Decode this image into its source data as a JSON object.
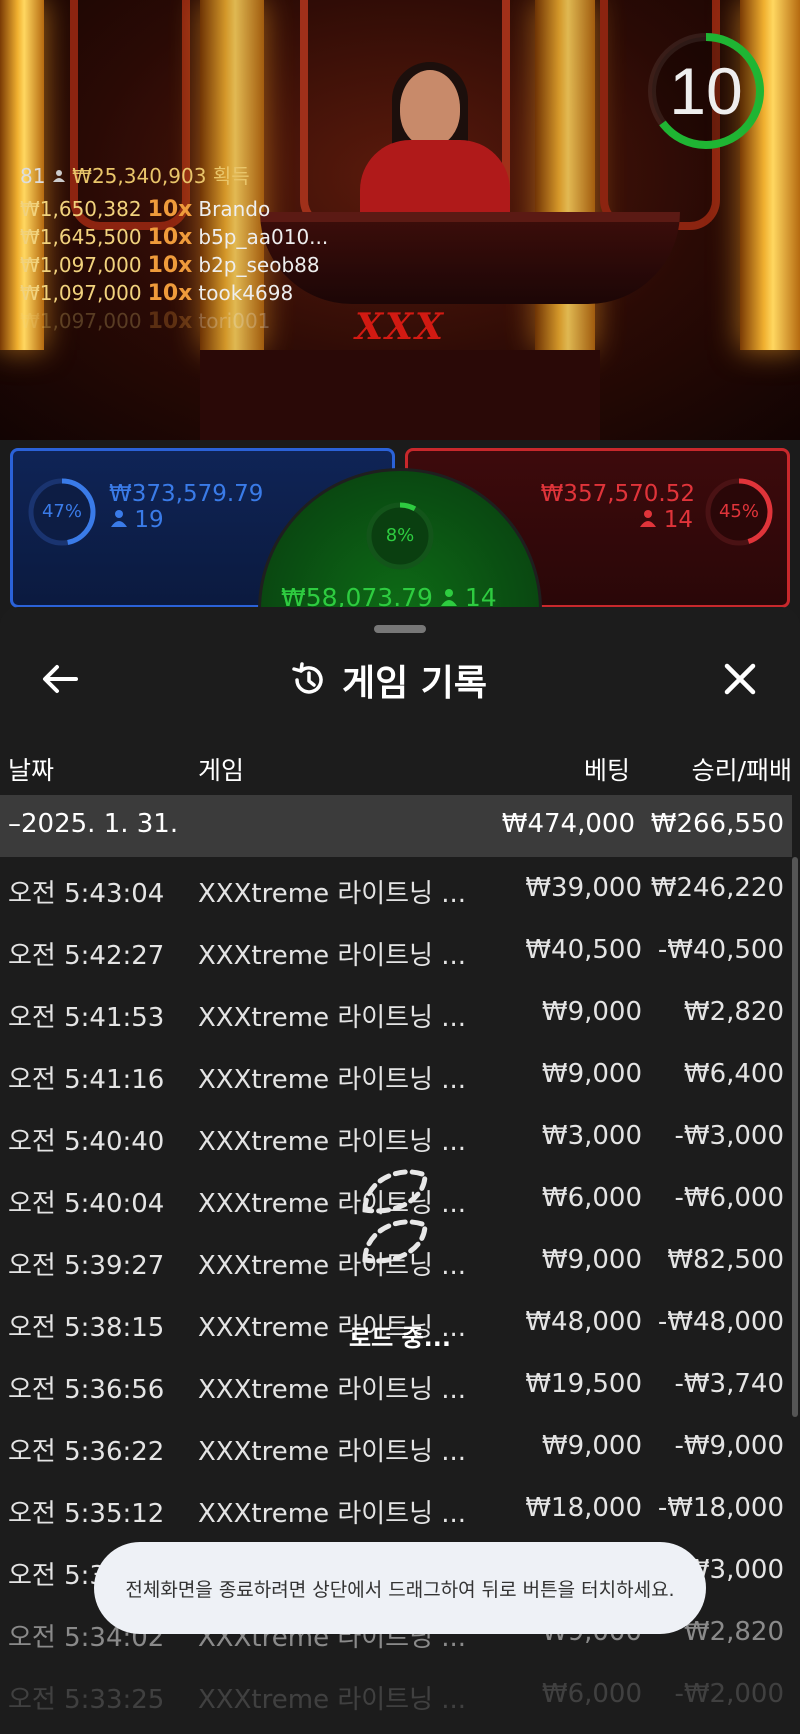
{
  "live": {
    "winners_count": "81",
    "winners_total": "₩25,340,903 획득",
    "winners": [
      {
        "amount": "₩1,650,382",
        "mult": "10x",
        "name": "Brando"
      },
      {
        "amount": "₩1,645,500",
        "mult": "10x",
        "name": "b5p_aa010..."
      },
      {
        "amount": "₩1,097,000",
        "mult": "10x",
        "name": "b2p_seob88"
      },
      {
        "amount": "₩1,097,000",
        "mult": "10x",
        "name": "took4698"
      },
      {
        "amount": "₩1,097,000",
        "mult": "10x",
        "name": "tori001"
      }
    ],
    "timer": "10",
    "table_logo": "XXX"
  },
  "bets": {
    "player": {
      "pct": "47%",
      "amount": "₩373,579.79",
      "count": "19",
      "pct_value": 0.47,
      "color": "#3a7be8"
    },
    "banker": {
      "pct": "45%",
      "amount": "₩357,570.52",
      "count": "14",
      "pct_value": 0.45,
      "color": "#e0343a"
    },
    "tie": {
      "pct": "8%",
      "amount": "₩58,073.79",
      "count": "14",
      "pct_value": 0.08,
      "color": "#2ecc40"
    }
  },
  "sheet": {
    "title": "게임 기록",
    "headers": {
      "date": "날짜",
      "game": "게임",
      "bet": "베팅",
      "result": "승리/패배"
    },
    "date_group": {
      "date": "–2025. 1. 31.",
      "bet": "₩474,000",
      "result": "₩266,550"
    },
    "rows": [
      {
        "time": "오전 5:43:04",
        "game": "XXXtreme 라이트닝 ...",
        "bet": "₩39,000",
        "result": "₩246,220"
      },
      {
        "time": "오전 5:42:27",
        "game": "XXXtreme 라이트닝 ...",
        "bet": "₩40,500",
        "result": "-₩40,500"
      },
      {
        "time": "오전 5:41:53",
        "game": "XXXtreme 라이트닝 ...",
        "bet": "₩9,000",
        "result": "₩2,820"
      },
      {
        "time": "오전 5:41:16",
        "game": "XXXtreme 라이트닝 ...",
        "bet": "₩9,000",
        "result": "₩6,400"
      },
      {
        "time": "오전 5:40:40",
        "game": "XXXtreme 라이트닝 ...",
        "bet": "₩3,000",
        "result": "-₩3,000"
      },
      {
        "time": "오전 5:40:04",
        "game": "XXXtreme 라이트닝 ...",
        "bet": "₩6,000",
        "result": "-₩6,000"
      },
      {
        "time": "오전 5:39:27",
        "game": "XXXtreme 라이트닝 ...",
        "bet": "₩9,000",
        "result": "₩82,500"
      },
      {
        "time": "오전 5:38:15",
        "game": "XXXtreme 라이트닝 ...",
        "bet": "₩48,000",
        "result": "-₩48,000"
      },
      {
        "time": "오전 5:36:56",
        "game": "XXXtreme 라이트닝 ...",
        "bet": "₩19,500",
        "result": "-₩3,740"
      },
      {
        "time": "오전 5:36:22",
        "game": "XXXtreme 라이트닝 ...",
        "bet": "₩9,000",
        "result": "-₩9,000"
      },
      {
        "time": "오전 5:35:12",
        "game": "XXXtreme 라이트닝 ...",
        "bet": "₩18,000",
        "result": "-₩18,000"
      },
      {
        "time": "오전 5:34:50",
        "game": "XXXtreme 라이트닝 ...",
        "bet": "₩3,000",
        "result": "-₩3,000"
      },
      {
        "time": "오전 5:34:02",
        "game": "XXXtreme 라이트닝 ...",
        "bet": "₩9,000",
        "result": "₩2,820"
      },
      {
        "time": "오전 5:33:25",
        "game": "XXXtreme 라이트닝 ...",
        "bet": "₩6,000",
        "result": "-₩2,000"
      }
    ],
    "loading_text": "로드 중..."
  },
  "toast": "전체화면을 종료하려면 상단에서 드래그하여 뒤로 버튼을 터치하세요.",
  "icons": {
    "back": "arrow-left-icon",
    "history": "history-icon",
    "close": "close-icon",
    "user": "user-icon",
    "spinner": "loading-spinner-icon"
  }
}
